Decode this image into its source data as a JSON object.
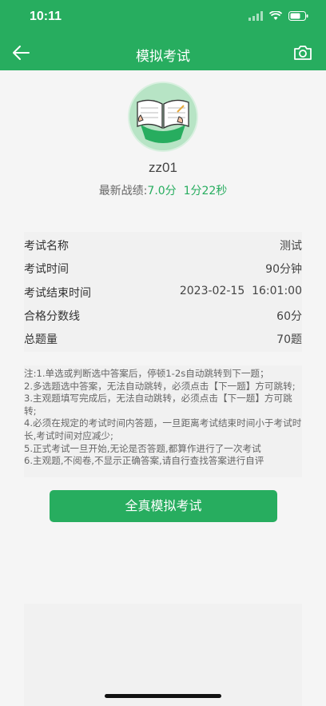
{
  "status_bar": {
    "time": "10:11"
  },
  "nav": {
    "title": "模拟考试"
  },
  "profile": {
    "username": "zz01",
    "record_label": "最新战绩:",
    "record_score": "7.0分",
    "record_time": "1分22秒"
  },
  "info": [
    {
      "label": "考试名称",
      "value": "测试"
    },
    {
      "label": "考试时间",
      "value": "90分钟"
    },
    {
      "label": "考试结束时间",
      "value": "2023-02-15  16:01:00"
    },
    {
      "label": "合格分数线",
      "value": "60分"
    },
    {
      "label": "总题量",
      "value": "70题"
    }
  ],
  "notes": [
    "注:1.单选或判断选中答案后，停顿1-2s自动跳转到下一题；",
    "2.多选题选中答案，无法自动跳转，必须点击【下一题】方可跳转;",
    "3.主观题填写完成后，无法自动跳转，必须点击【下一题】方可跳转;",
    "4.必须在规定的考试时间内答题，一旦距离考试结束时间小于考试时长,考试时间对应减少;",
    "5.正式考试一旦开始,无论是否答题,都算作进行了一次考试",
    "6.主观题,不阅卷,不显示正确答案,请自行查找答案进行自评"
  ],
  "start_button": {
    "label": "全真模拟考试"
  },
  "colors": {
    "brand": "#27ad5f",
    "background": "#f5f5f5"
  },
  "icons": [
    "signal-icon",
    "wifi-icon",
    "battery-icon",
    "back-arrow-icon",
    "camera-icon",
    "reading-avatar"
  ]
}
